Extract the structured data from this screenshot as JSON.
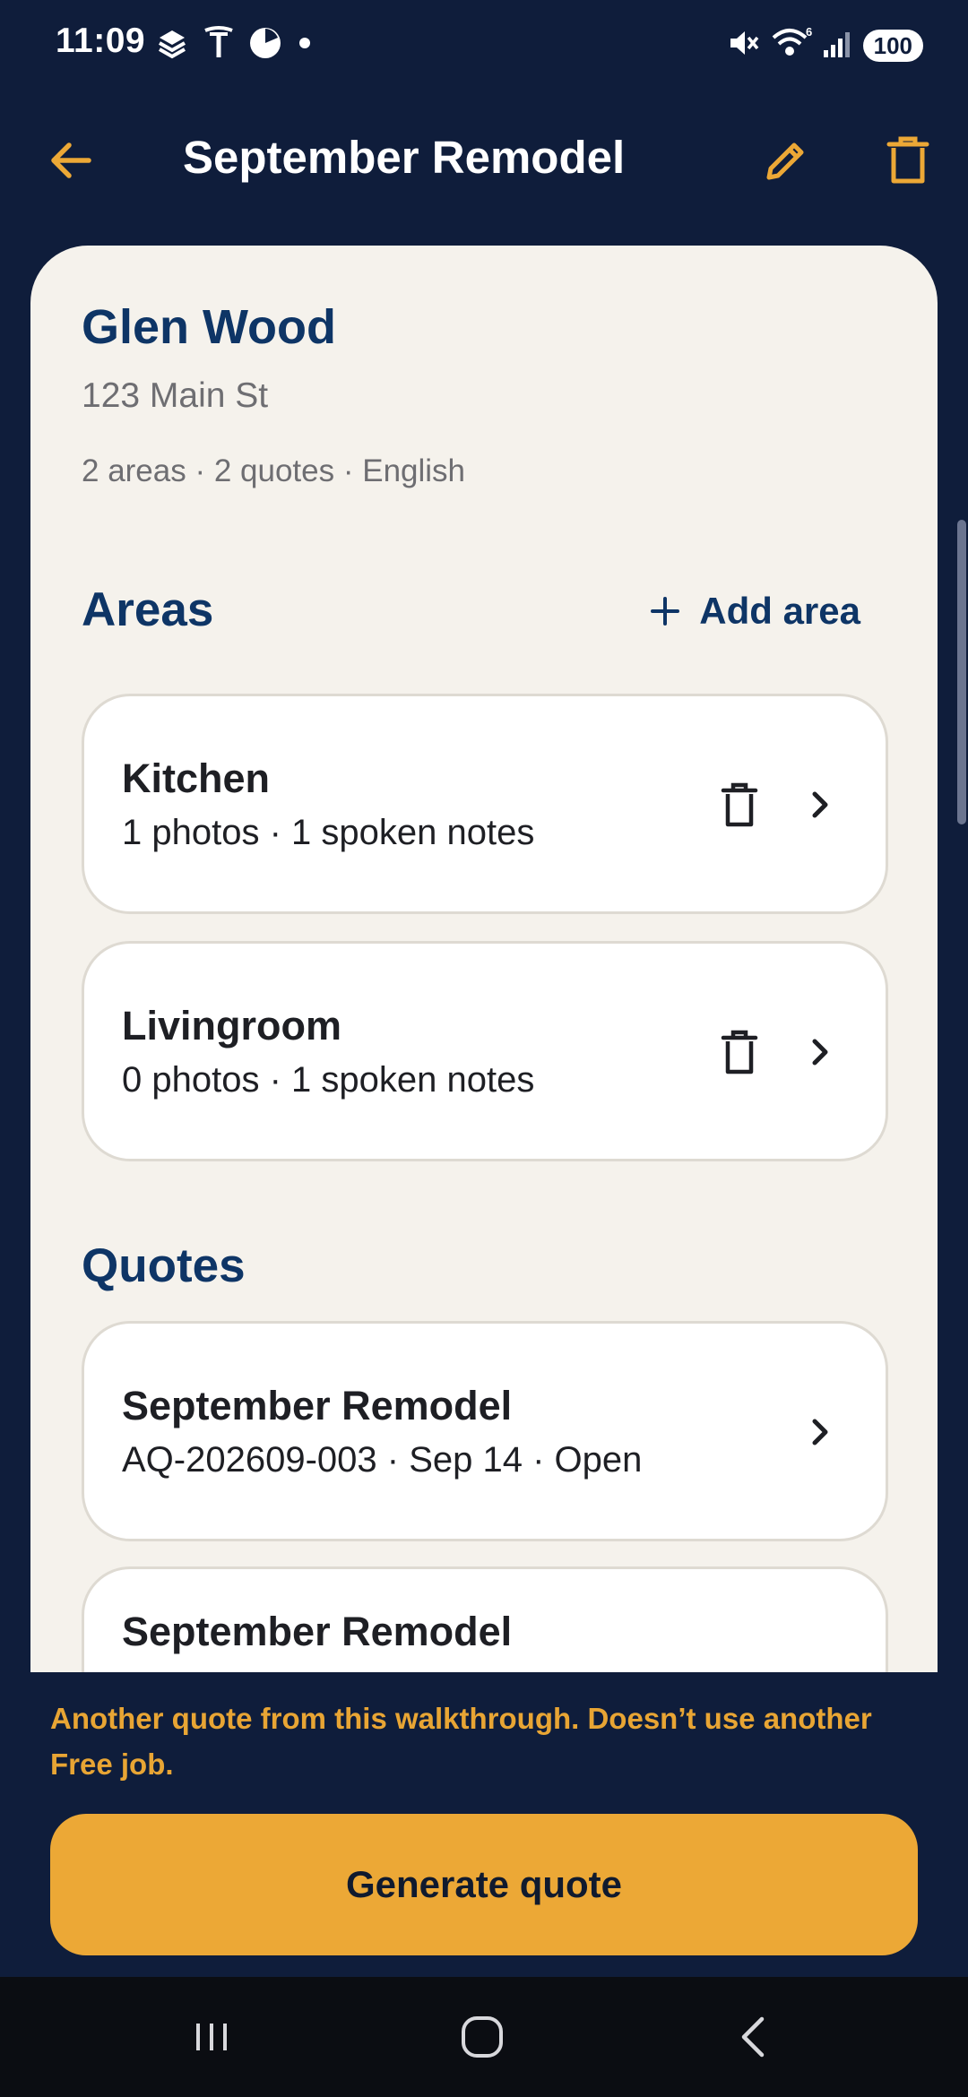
{
  "status_bar": {
    "time": "11:09",
    "battery": "100",
    "signal_superscript": "6"
  },
  "app_bar": {
    "title": "September Remodel"
  },
  "job": {
    "client_name": "Glen Wood",
    "address": "123 Main St",
    "meta": "2 areas · 2 quotes · English"
  },
  "areas_section": {
    "title": "Areas",
    "add_label": "Add area",
    "items": [
      {
        "name": "Kitchen",
        "summary": "1 photos · 1 spoken notes"
      },
      {
        "name": "Livingroom",
        "summary": "0 photos · 1 spoken notes"
      }
    ]
  },
  "quotes_section": {
    "title": "Quotes",
    "items": [
      {
        "name": "September Remodel",
        "summary": "AQ-202609-003 · Sep 14 · Open"
      },
      {
        "name": "September Remodel",
        "summary": ""
      }
    ]
  },
  "footer": {
    "note": "Another quote from this walkthrough. Doesn’t use another Free job.",
    "generate_label": "Generate quote"
  },
  "colors": {
    "background": "#0f1d3b",
    "accent": "#eca836",
    "sheet": "#f5f2ec",
    "heading": "#0e3566"
  }
}
